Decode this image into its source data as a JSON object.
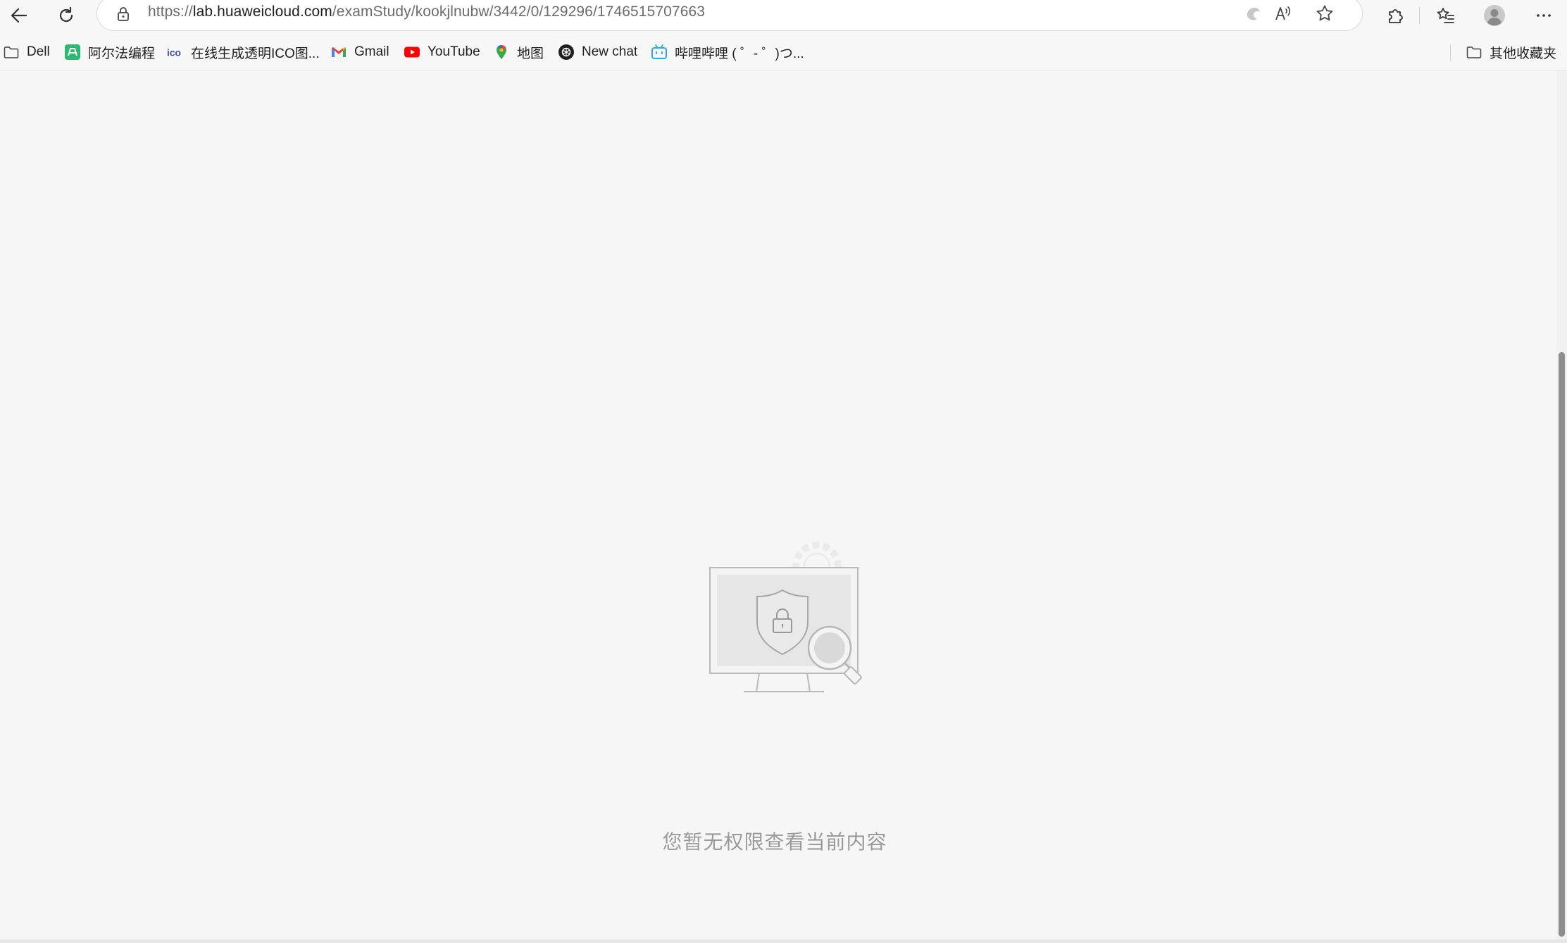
{
  "browser": {
    "url_prefix": "https://",
    "url_host": "lab.huaweicloud.com",
    "url_path": "/examStudy/kookjlnubw/3442/0/129296/1746515707663"
  },
  "bookmarks": [
    {
      "label": "Dell",
      "icon": "folder-icon"
    },
    {
      "label": "阿尔法编程",
      "icon": "alpha-coding-icon"
    },
    {
      "label": "在线生成透明ICO图...",
      "icon": "ico-icon"
    },
    {
      "label": "Gmail",
      "icon": "gmail-icon"
    },
    {
      "label": "YouTube",
      "icon": "youtube-icon"
    },
    {
      "label": "地图",
      "icon": "maps-pin-icon"
    },
    {
      "label": "New chat",
      "icon": "chatgpt-icon"
    },
    {
      "label": "哔哩哔哩 ( ゜- ゜)つ...",
      "icon": "bilibili-icon"
    }
  ],
  "other_bookmarks": {
    "label": "其他收藏夹",
    "icon": "folder-icon"
  },
  "content": {
    "message": "您暂无权限查看当前内容"
  },
  "colors": {
    "page_bg": "#f6f6f6",
    "message_text": "#9a9a9a",
    "youtube_red": "#ff0000",
    "bilibili_blue": "#23ade5"
  }
}
